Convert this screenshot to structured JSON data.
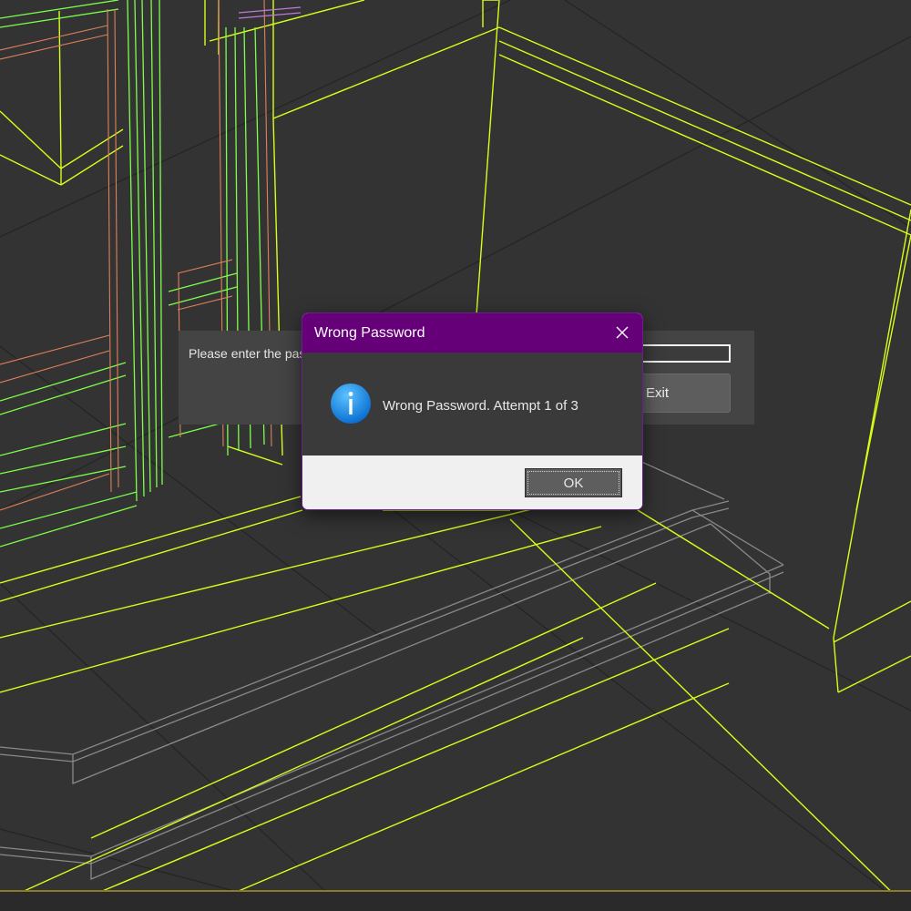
{
  "background_dialog": {
    "prompt": "Please enter the password",
    "password_value": "",
    "exit_label": "Exit"
  },
  "message_box": {
    "title": "Wrong Password",
    "message": "Wrong Password. Attempt 1 of 3",
    "ok_label": "OK",
    "icon": "info-icon"
  },
  "colors": {
    "titlebar": "#650079",
    "viewport_background": "#333333",
    "wireframe_yellow": "#d7ff19",
    "wireframe_green": "#7dff4a",
    "wireframe_orange": "#e0805a"
  }
}
